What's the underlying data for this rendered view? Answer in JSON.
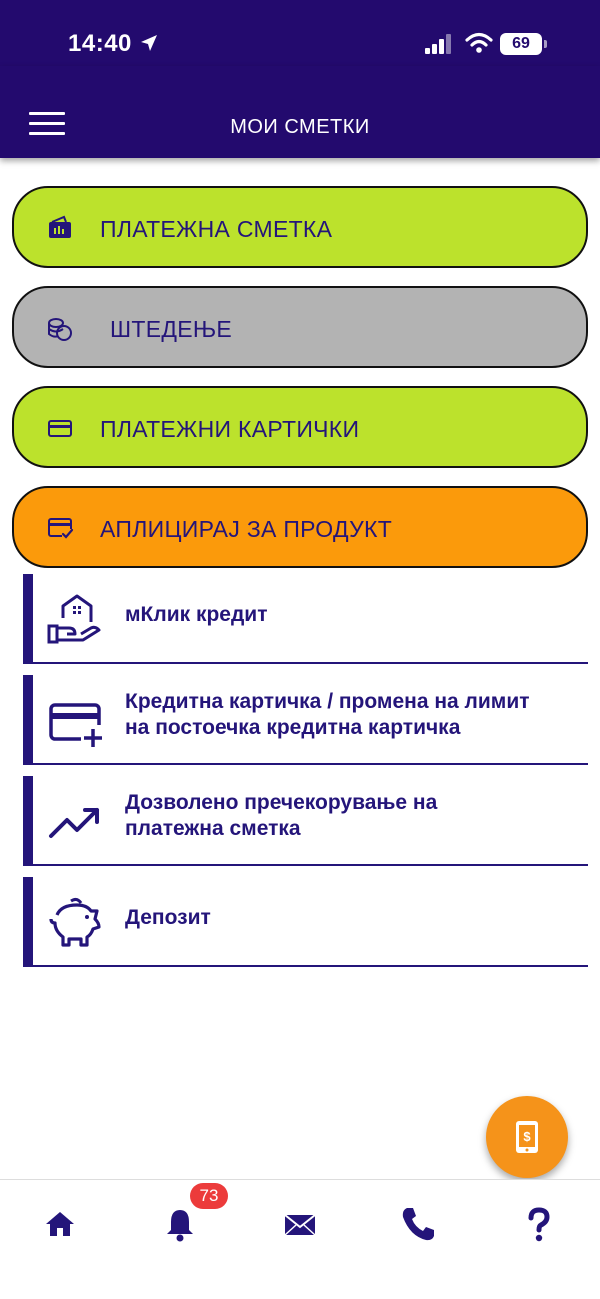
{
  "status": {
    "time": "14:40",
    "battery": "69"
  },
  "header": {
    "title": "МОИ СМЕТКИ"
  },
  "accounts": [
    {
      "label": "ПЛАТЕЖНА СМЕТКА",
      "icon": "wallet-icon",
      "color": "#bce22c"
    },
    {
      "label": "ШТЕДЕЊЕ",
      "icon": "coins-icon",
      "color": "#b3b3b3"
    },
    {
      "label": "ПЛАТЕЖНИ КАРТИЧКИ",
      "icon": "card-icon",
      "color": "#bce22c"
    },
    {
      "label": "АПЛИЦИРАЈ ЗА ПРОДУКТ",
      "icon": "card-check-icon",
      "color": "#fb9a0b"
    }
  ],
  "products": [
    {
      "line1": "мКлик кредит",
      "line2": "",
      "icon": "house-hand-icon"
    },
    {
      "line1": "Кредитна картичка / промена на лимит",
      "line2": "на постоечка кредитна картичка",
      "icon": "card-plus-icon"
    },
    {
      "line1": "Дозволено пречекорување на",
      "line2": "платежна сметка",
      "icon": "trend-up-icon"
    },
    {
      "line1": "Депозит",
      "line2": "",
      "icon": "piggy-bank-icon"
    }
  ],
  "tabbar": {
    "notifications_badge": "73"
  },
  "colors": {
    "primary": "#230a6e",
    "accent": "#f5931a",
    "green": "#bce22c",
    "badge": "#ec3b3b"
  }
}
